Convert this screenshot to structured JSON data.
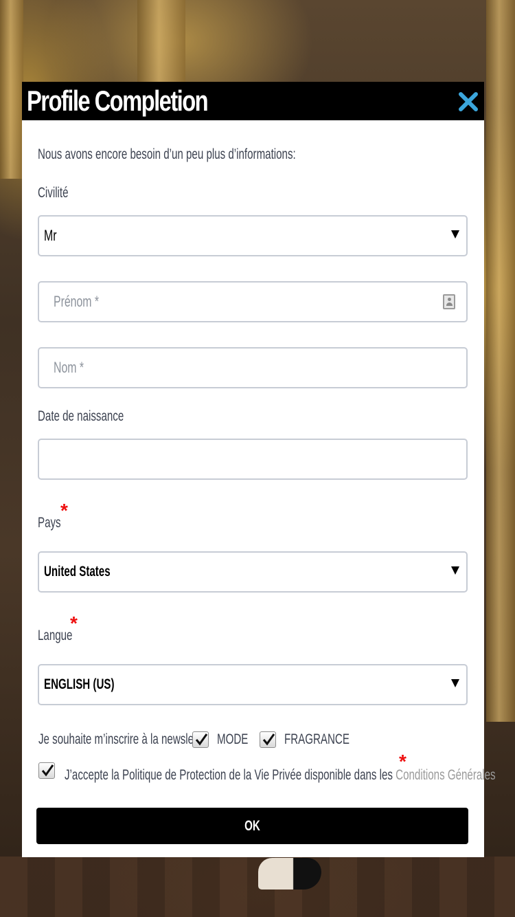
{
  "modal": {
    "title": "Profile Completion",
    "close_icon": "close-x-icon",
    "intro": "Nous avons encore besoin d’un peu plus d’informations:"
  },
  "form": {
    "civilite": {
      "label": "Civilité",
      "value": "Mr",
      "icon": "dropdown-caret-icon"
    },
    "prenom": {
      "placeholder": "Prénom *",
      "value": "",
      "icon": "contact-card-icon"
    },
    "nom": {
      "placeholder": "Nom *",
      "value": ""
    },
    "date_naissance": {
      "label": "Date de naissance",
      "value": ""
    },
    "pays": {
      "label": "Pays",
      "required_mark": "*",
      "value": "United States"
    },
    "langue": {
      "label": "Langue",
      "required_mark": "*",
      "value": "ENGLISH (US)"
    }
  },
  "newsletter": {
    "label": "Je souhaite m’inscrire à la newsletter",
    "options": [
      {
        "label": "MODE",
        "checked": true
      },
      {
        "label": "FRAGRANCE",
        "checked": true
      }
    ]
  },
  "privacy": {
    "checked": true,
    "text": "J’accepte la Politique de Protection de la Vie Privée disponible dans les ",
    "link": "Conditions Générales",
    "required_mark": "*"
  },
  "submit": {
    "label": "OK"
  },
  "colors": {
    "header_bg": "#000000",
    "close_icon": "#3ba6dc",
    "required": "#ee1111",
    "label_text": "#3c4250",
    "link_text": "#9a9a9a"
  }
}
